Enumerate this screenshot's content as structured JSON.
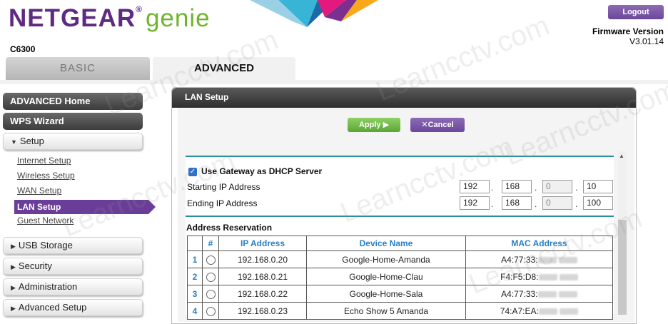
{
  "header": {
    "brand_netgear": "NETGEAR",
    "brand_reg": "®",
    "brand_genie": "genie",
    "model": "C6300",
    "logout_label": "Logout",
    "firmware_label": "Firmware Version",
    "firmware_value": "V3.01.14"
  },
  "tabs": {
    "basic": "BASIC",
    "advanced": "ADVANCED"
  },
  "nav": {
    "advanced_home": "ADVANCED Home",
    "wps_wizard": "WPS Wizard",
    "setup": "Setup",
    "setup_items": [
      "Internet Setup",
      "Wireless Setup",
      "WAN Setup",
      "LAN Setup",
      "Guest Network"
    ],
    "usb_storage": "USB Storage",
    "security": "Security",
    "administration": "Administration",
    "advanced_setup": "Advanced Setup"
  },
  "panel": {
    "title": "LAN Setup",
    "apply_label": "Apply",
    "cancel_label": "Cancel",
    "use_gateway_label": "Use Gateway as DHCP Server",
    "use_gateway_checked": true,
    "starting_ip_label": "Starting IP Address",
    "starting_ip": [
      "192",
      "168",
      "0",
      "10"
    ],
    "ending_ip_label": "Ending IP Address",
    "ending_ip": [
      "192",
      "168",
      "0",
      "100"
    ],
    "reservation_title": "Address Reservation",
    "columns": [
      "#",
      "IP Address",
      "Device Name",
      "MAC Address"
    ],
    "rows": [
      {
        "num": "1",
        "ip": "192.168.0.20",
        "device": "Google-Home-Amanda",
        "mac_prefix": "A4:77:33:"
      },
      {
        "num": "2",
        "ip": "192.168.0.21",
        "device": "Google-Home-Clau",
        "mac_prefix": "F4:F5:D8:"
      },
      {
        "num": "3",
        "ip": "192.168.0.22",
        "device": "Google-Home-Sala",
        "mac_prefix": "A4:77:33:"
      },
      {
        "num": "4",
        "ip": "192.168.0.23",
        "device": "Echo Show 5 Amanda",
        "mac_prefix": "74:A7:EA:"
      }
    ]
  },
  "watermark": "Learncctv.com",
  "colors": {
    "purple": "#6a3e98",
    "green": "#6fb52c",
    "teal": "#2b8ea0",
    "link_blue": "#2a7fc4"
  }
}
